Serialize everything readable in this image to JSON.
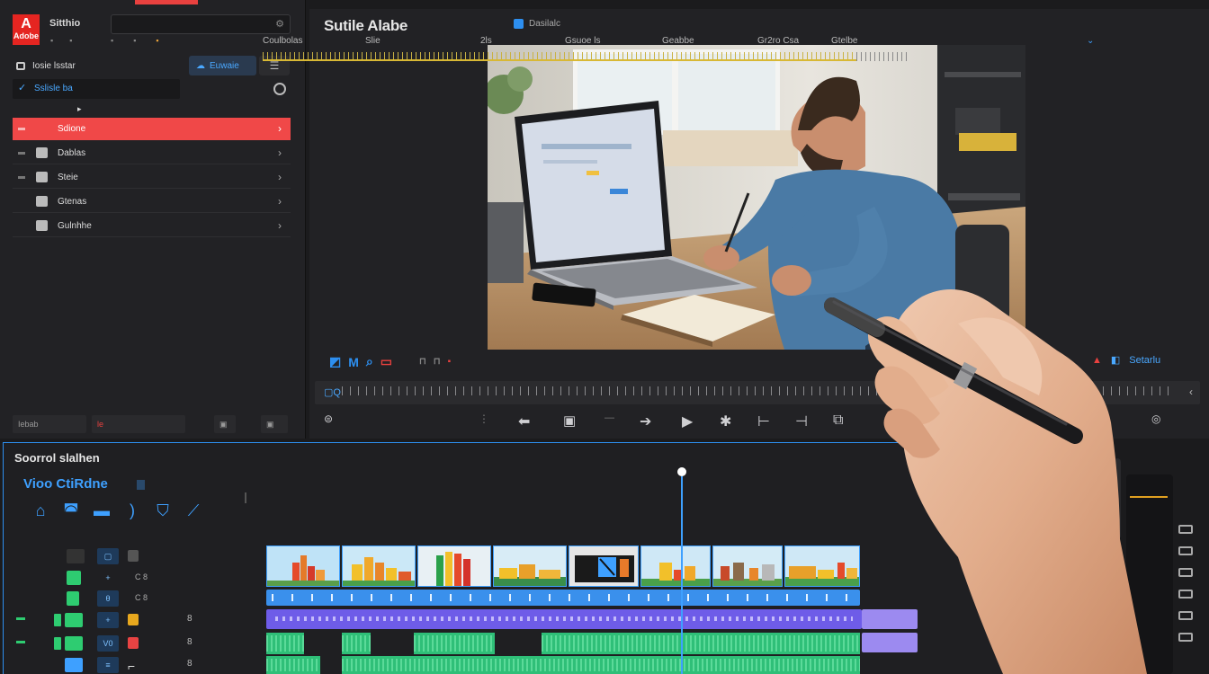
{
  "app": {
    "logo_text": "Adobe",
    "name": "Sitthio",
    "search_placeholder": ""
  },
  "sidebar": {
    "header_label": "Iosie lsstar",
    "blue_button_label": "Euwaie",
    "filter_label": "Sslisle ba",
    "items": [
      {
        "label": "Sdione",
        "active": true
      },
      {
        "label": "Dablas",
        "active": false
      },
      {
        "label": "Steie",
        "active": false
      },
      {
        "label": "Gtenas",
        "active": false
      },
      {
        "label": "Gulnhhe",
        "active": false
      }
    ],
    "bottom_left": "Iebab",
    "bottom_mid": "le"
  },
  "monitor": {
    "title": "Sutile Alabe",
    "subtitle": "Dasilalc",
    "tools_right": "Setarlu",
    "ruler_start": "▢Q"
  },
  "timeline": {
    "title": "Soorrol slalhen",
    "subtitle": "Vioo CtiRdne",
    "ruler_labels": [
      "Coulbolas",
      "Slie",
      "2ls",
      "Gsuoe ls",
      "Geabbe",
      "Gr2ro Csa",
      "Gtelbe"
    ]
  },
  "colors": {
    "accent_red": "#f04848",
    "accent_blue": "#3ea0ff",
    "timeline_purple": "#6e5ce8",
    "audio_green": "#2fbf78",
    "ruler_gold": "#d8b835"
  }
}
